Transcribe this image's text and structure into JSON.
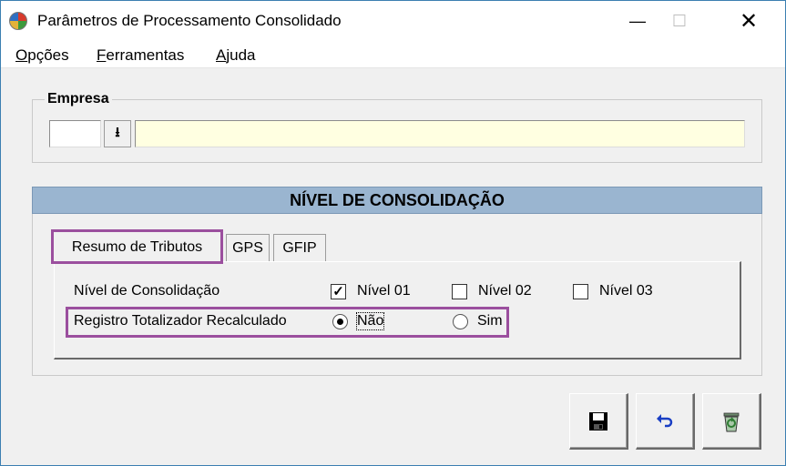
{
  "window": {
    "title": "Parâmetros de Processamento Consolidado",
    "minimize_glyph": "—",
    "maximize_glyph": "☐",
    "close_glyph": "✕"
  },
  "menu": {
    "items": [
      {
        "accel": "O",
        "rest": "pções"
      },
      {
        "accel": "F",
        "rest": "erramentas"
      },
      {
        "accel": "A",
        "rest": "juda"
      }
    ]
  },
  "empresa": {
    "group_label": "Empresa",
    "code_value": "",
    "dropdown_glyph": "⭳",
    "name_value": ""
  },
  "consolidation": {
    "header": "NÍVEL DE CONSOLIDAÇÃO",
    "tabs": [
      "Resumo de Tributos",
      "GPS",
      "GFIP"
    ],
    "active_tab": 0,
    "nivel_label": "Nível de Consolidação",
    "levels": [
      {
        "label": "Nível 01",
        "checked": true
      },
      {
        "label": "Nível 02",
        "checked": false
      },
      {
        "label": "Nível 03",
        "checked": false
      }
    ],
    "registro_label": "Registro Totalizador Recalculado",
    "registro_options": [
      {
        "label": "Não",
        "selected": true
      },
      {
        "label": "Sim",
        "selected": false
      }
    ]
  },
  "toolbar": {
    "icons": [
      "save-icon",
      "undo-icon",
      "recycle-bin-icon"
    ]
  },
  "colors": {
    "header_bg": "#9ab5d0",
    "name_field_bg": "#ffffe1",
    "highlight": "#9b4f9e",
    "undo_blue": "#1a3fc4"
  }
}
